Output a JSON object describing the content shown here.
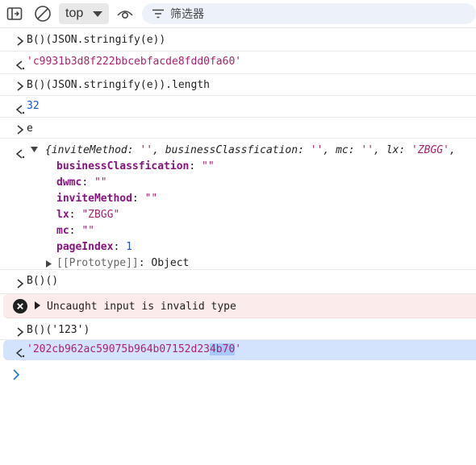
{
  "toolbar": {
    "context": "top",
    "filter_placeholder": "筛选器",
    "icons": [
      "sidebar-toggle-icon",
      "clear-console-icon",
      "chevron-down-icon",
      "live-expression-eye-icon",
      "filter-icon"
    ]
  },
  "console": {
    "entry1_input": "B()(JSON.stringify(e))",
    "entry1_result": "'c9931b3d8f222bbcebfacde8fdd0fa60'",
    "entry2_input": "B()(JSON.stringify(e)).length",
    "entry2_result": "32",
    "entry3_input": "e",
    "obj_summary": {
      "open": "{",
      "k1": "inviteMethod",
      "v1": "''",
      "k2": "businessClassfication",
      "v2": "''",
      "k3": "mc",
      "v3": "''",
      "k4": "lx",
      "v4": "'ZBGG'",
      "tail": ","
    },
    "obj_props": [
      {
        "key": "businessClassfication",
        "sep": ": ",
        "value": "\"\""
      },
      {
        "key": "dwmc",
        "sep": ": ",
        "value": "\"\""
      },
      {
        "key": "inviteMethod",
        "sep": ": ",
        "value": "\"\""
      },
      {
        "key": "lx",
        "sep": ": ",
        "value": "\"ZBGG\""
      },
      {
        "key": "mc",
        "sep": ": ",
        "value": "\"\""
      },
      {
        "key": "pageIndex",
        "sep": ": ",
        "value": "1"
      }
    ],
    "prototype": {
      "label": "[[Prototype]]",
      "sep": ": ",
      "value": "Object"
    },
    "entry4_input": "B()()",
    "error_text": "Uncaught input is invalid type",
    "entry5_input": "B()('123')",
    "entry5_result_a": "'202cb962ac59075b964b07152d23",
    "entry5_result_sel": "4b70",
    "entry5_result_b": "'"
  },
  "colors": {
    "string": "#a8236b",
    "number": "#1a55c6",
    "key": "#881280",
    "error_bg": "#fcebeb",
    "selected_bg": "#d3e3fd",
    "prompt_blue": "#1a73e8"
  }
}
